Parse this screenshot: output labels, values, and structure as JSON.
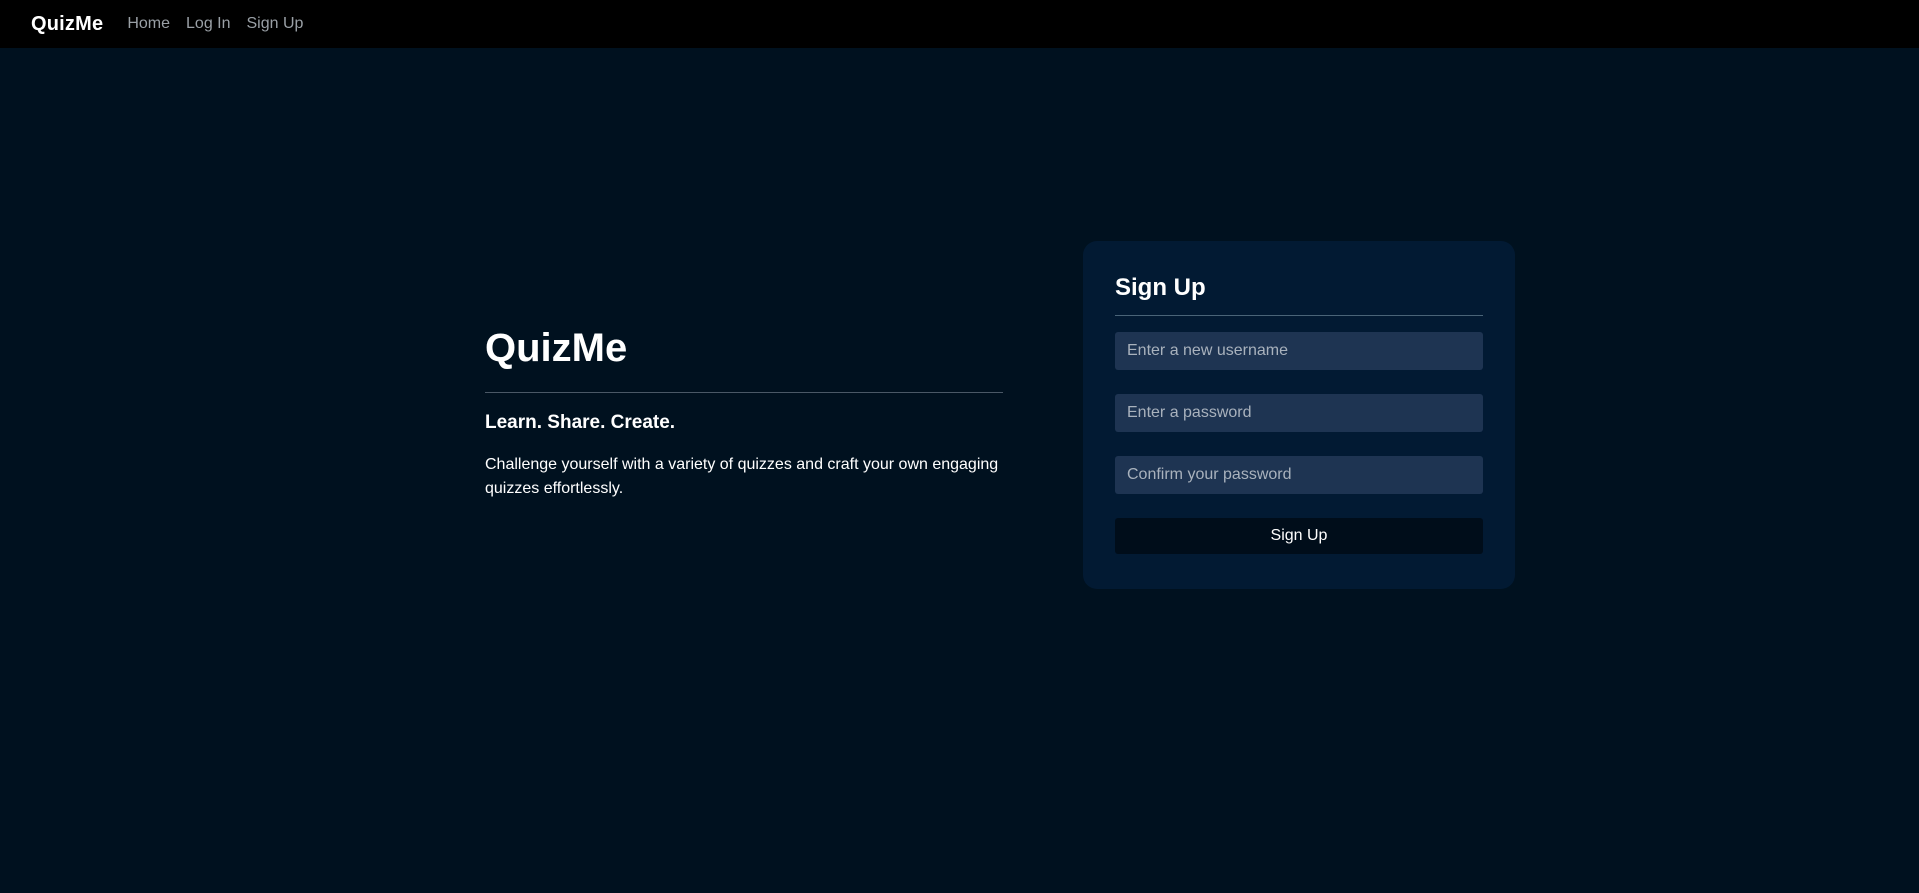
{
  "navbar": {
    "brand": "QuizMe",
    "links": [
      {
        "label": "Home"
      },
      {
        "label": "Log In"
      },
      {
        "label": "Sign Up"
      }
    ]
  },
  "hero": {
    "title": "QuizMe",
    "subtitle": "Learn. Share. Create.",
    "description": "Challenge yourself with a variety of quizzes and craft your own engaging quizzes effortlessly."
  },
  "signup": {
    "title": "Sign Up",
    "username_placeholder": "Enter a new username",
    "username_value": "",
    "password_placeholder": "Enter a password",
    "password_value": "",
    "confirm_placeholder": "Confirm your password",
    "confirm_value": "",
    "submit_label": "Sign Up"
  },
  "colors": {
    "background": "#00111f",
    "navbar": "#000000",
    "card": "#021a33",
    "input": "#1e3452",
    "button": "#000d1a"
  }
}
